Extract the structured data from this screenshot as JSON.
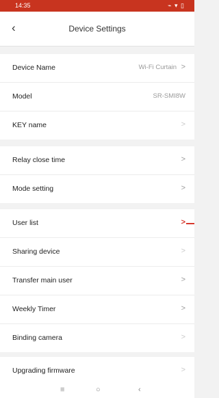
{
  "status_bar": {
    "time": "14:35",
    "icons": "⌁ ▾ ▯"
  },
  "header": {
    "title": "Device Settings"
  },
  "groups": [
    {
      "rows": [
        {
          "label": "Device Name",
          "value": "Wi-Fi Curtain",
          "chevron": true
        },
        {
          "label": "Model",
          "value": "SR-SMI8W",
          "chevron": false
        },
        {
          "label": "KEY name",
          "value": "",
          "chevron": true
        }
      ]
    },
    {
      "rows": [
        {
          "label": "Relay close time",
          "value": "",
          "chevron": true
        },
        {
          "label": "Mode setting",
          "value": "",
          "chevron": true
        }
      ]
    },
    {
      "rows": [
        {
          "label": "User list",
          "value": "",
          "chevron": true
        },
        {
          "label": "Sharing device",
          "value": "",
          "chevron": true
        },
        {
          "label": "Transfer main user",
          "value": "",
          "chevron": true
        },
        {
          "label": "Weekly Timer",
          "value": "",
          "chevron": true
        },
        {
          "label": "Binding camera",
          "value": "",
          "chevron": true
        }
      ]
    },
    {
      "rows": [
        {
          "label": "Upgrading firmware",
          "value": "",
          "chevron": true
        }
      ]
    }
  ],
  "nav_bar": {
    "menu": "≡",
    "home": "○",
    "back": "‹"
  }
}
